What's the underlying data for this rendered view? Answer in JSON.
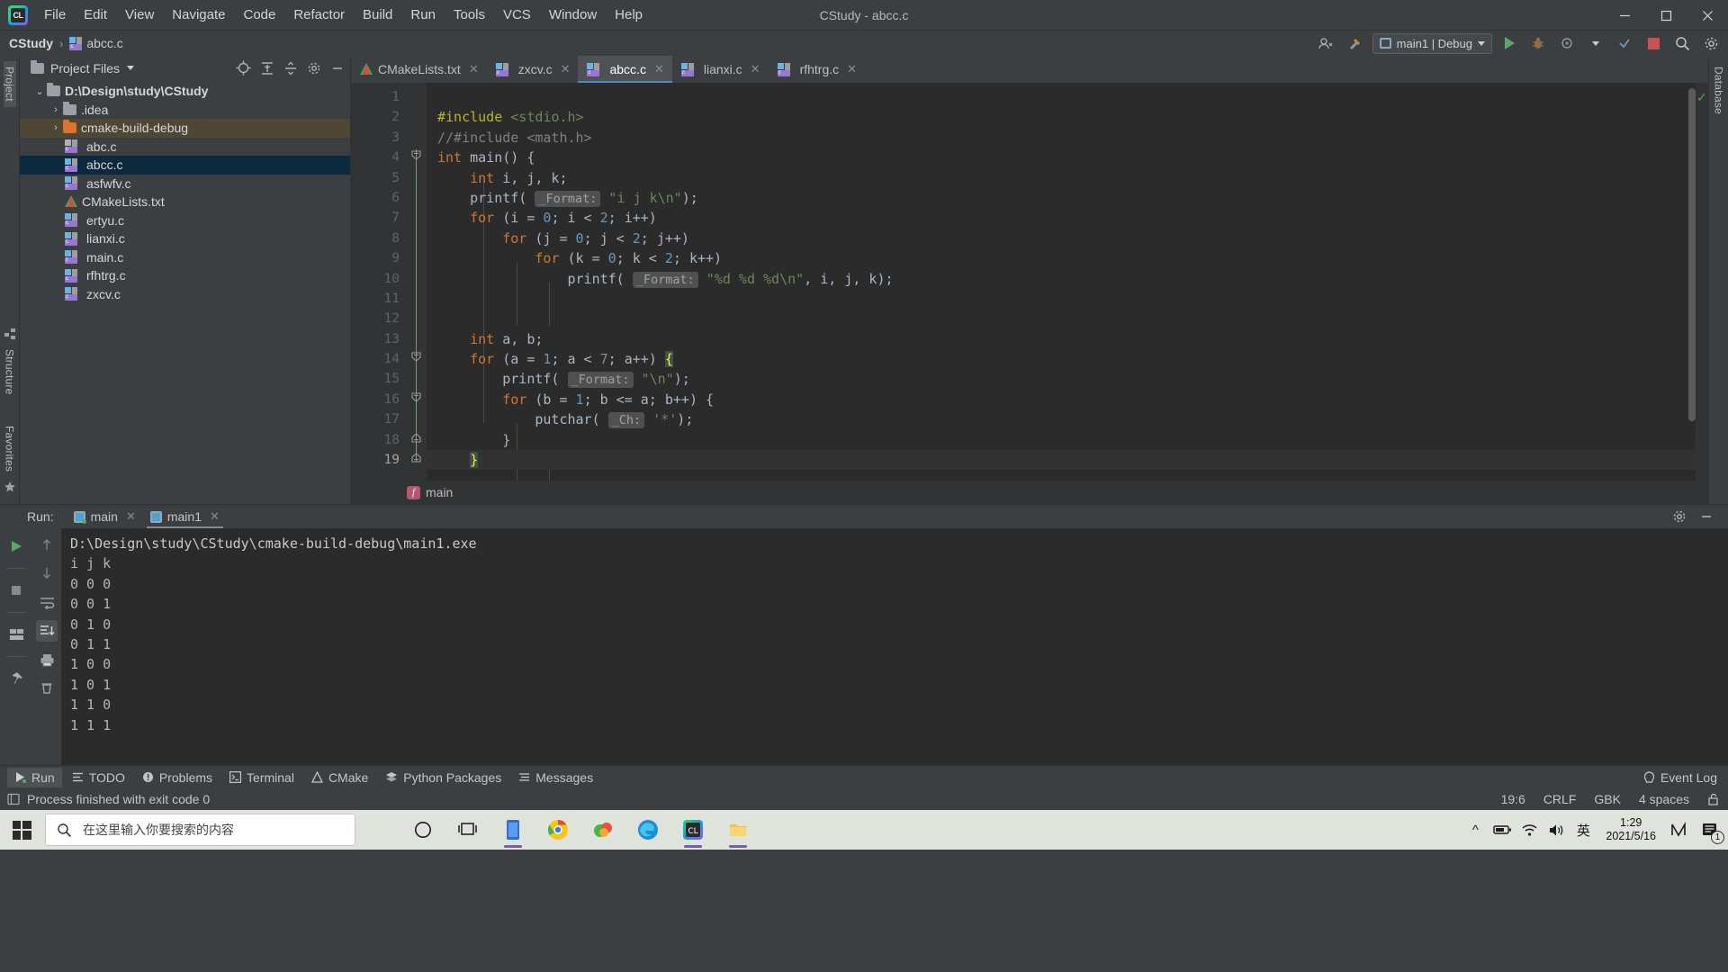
{
  "window": {
    "title": "CStudy - abcc.c",
    "minimize": "–",
    "maximize": "▢",
    "close": "✕"
  },
  "menu": [
    "File",
    "Edit",
    "View",
    "Navigate",
    "Code",
    "Refactor",
    "Build",
    "Run",
    "Tools",
    "VCS",
    "Window",
    "Help"
  ],
  "navbar": {
    "project": "CStudy",
    "separator": "›",
    "file": "abcc.c",
    "run_config": "main1 | Debug",
    "icons": {
      "account": "account-icon",
      "hammer": "build-hammer-icon",
      "run": "run-icon",
      "debug": "debug-icon",
      "attach": "attach-profiler-icon",
      "more": "more-run-icon",
      "coverage": "run-coverage-icon",
      "stop": "stop-icon",
      "search": "search-everywhere-icon",
      "settings": "settings-icon"
    }
  },
  "rails": {
    "left_top": "Project",
    "left_mid": "Structure",
    "left_bottom": "Favorites",
    "right_top": "Database"
  },
  "project_panel": {
    "title": "Project Files",
    "header_icons": [
      "locate-icon",
      "expand-all-icon",
      "collapse-all-icon",
      "settings-icon",
      "hide-icon"
    ],
    "tree": [
      {
        "label": "D:\\Design\\study\\CStudy",
        "type": "root-folder",
        "indent": 0,
        "arrow": "⌄",
        "state": "normal",
        "bold": true
      },
      {
        "label": ".idea",
        "type": "folder",
        "indent": 1,
        "arrow": "›",
        "state": "normal",
        "bold": false
      },
      {
        "label": "cmake-build-debug",
        "type": "folder-orange",
        "indent": 1,
        "arrow": "›",
        "state": "highlight",
        "bold": false
      },
      {
        "label": "abc.c",
        "type": "c-file",
        "indent": 2,
        "arrow": "",
        "state": "normal",
        "bold": false
      },
      {
        "label": "abcc.c",
        "type": "c-file",
        "indent": 2,
        "arrow": "",
        "state": "selected",
        "bold": false
      },
      {
        "label": "asfwfv.c",
        "type": "c-file",
        "indent": 2,
        "arrow": "",
        "state": "normal",
        "bold": false
      },
      {
        "label": "CMakeLists.txt",
        "type": "cmake-file",
        "indent": 2,
        "arrow": "",
        "state": "normal",
        "bold": false
      },
      {
        "label": "ertyu.c",
        "type": "c-file",
        "indent": 2,
        "arrow": "",
        "state": "normal",
        "bold": false
      },
      {
        "label": "lianxi.c",
        "type": "c-file",
        "indent": 2,
        "arrow": "",
        "state": "normal",
        "bold": false
      },
      {
        "label": "main.c",
        "type": "c-file",
        "indent": 2,
        "arrow": "",
        "state": "normal",
        "bold": false
      },
      {
        "label": "rfhtrg.c",
        "type": "c-file",
        "indent": 2,
        "arrow": "",
        "state": "normal",
        "bold": false
      },
      {
        "label": "zxcv.c",
        "type": "c-file",
        "indent": 2,
        "arrow": "",
        "state": "normal",
        "bold": false
      }
    ]
  },
  "editor": {
    "tabs": [
      {
        "label": "CMakeLists.txt",
        "icon": "cmake-file-icon",
        "active": false,
        "close": "✕"
      },
      {
        "label": "zxcv.c",
        "icon": "c-file-icon",
        "active": false,
        "close": "✕"
      },
      {
        "label": "abcc.c",
        "icon": "c-file-icon",
        "active": true,
        "close": "✕"
      },
      {
        "label": "lianxi.c",
        "icon": "c-file-icon",
        "active": false,
        "close": "✕"
      },
      {
        "label": "rfhtrg.c",
        "icon": "c-file-icon",
        "active": false,
        "close": "✕"
      }
    ],
    "lines": [
      {
        "n": "1",
        "text": ""
      },
      {
        "n": "2",
        "text": "#include <stdio.h>"
      },
      {
        "n": "3",
        "text": "//#include <math.h>"
      },
      {
        "n": "4",
        "text": "int main() {"
      },
      {
        "n": "5",
        "text": "    int i, j, k;"
      },
      {
        "n": "6",
        "text": "    printf( _Format: \"i j k\\n\");"
      },
      {
        "n": "7",
        "text": "    for (i = 0; i < 2; i++)"
      },
      {
        "n": "8",
        "text": "        for (j = 0; j < 2; j++)"
      },
      {
        "n": "9",
        "text": "            for (k = 0; k < 2; k++)"
      },
      {
        "n": "10",
        "text": "                printf( _Format: \"%d %d %d\\n\", i, j, k);"
      },
      {
        "n": "11",
        "text": ""
      },
      {
        "n": "12",
        "text": ""
      },
      {
        "n": "13",
        "text": "    int a, b;"
      },
      {
        "n": "14",
        "text": "    for (a = 1; a < 7; a++) {"
      },
      {
        "n": "15",
        "text": "        printf( _Format: \"\\n\");"
      },
      {
        "n": "16",
        "text": "        for (b = 1; b <= a; b++) {"
      },
      {
        "n": "17",
        "text": "            putchar( _Ch: '*');"
      },
      {
        "n": "18",
        "text": "        }"
      },
      {
        "n": "19",
        "text": "    }"
      }
    ],
    "breadcrumb": {
      "badge": "f",
      "label": "main"
    },
    "inspection_status": "✓"
  },
  "run_panel": {
    "label": "Run:",
    "tabs": [
      {
        "label": "main",
        "active": false,
        "close": "✕"
      },
      {
        "label": "main1",
        "active": true,
        "close": "✕"
      }
    ],
    "toolbar_left": [
      "rerun-icon",
      "stop-icon",
      "layout-icon",
      "pin-icon"
    ],
    "toolbar_right": [
      "up-arrow-icon",
      "down-arrow-icon",
      "soft-wrap-icon",
      "scroll-to-end-icon",
      "print-icon",
      "clear-all-icon"
    ],
    "settings_icon": "gear-icon",
    "minimize_icon": "minimize-icon",
    "console": [
      "D:\\Design\\study\\CStudy\\cmake-build-debug\\main1.exe",
      "i j k",
      "0 0 0",
      "0 0 1",
      "0 1 0",
      "0 1 1",
      "1 0 0",
      "1 0 1",
      "1 1 0",
      "1 1 1"
    ]
  },
  "tool_window_bar": {
    "buttons": [
      {
        "label": "Run",
        "icon": "run-icon",
        "active": true
      },
      {
        "label": "TODO",
        "icon": "todo-icon",
        "active": false
      },
      {
        "label": "Problems",
        "icon": "problems-icon",
        "active": false
      },
      {
        "label": "Terminal",
        "icon": "terminal-icon",
        "active": false
      },
      {
        "label": "CMake",
        "icon": "cmake-icon",
        "active": false
      },
      {
        "label": "Python Packages",
        "icon": "packages-icon",
        "active": false
      },
      {
        "label": "Messages",
        "icon": "messages-icon",
        "active": false
      }
    ],
    "event_log": {
      "label": "Event Log",
      "icon": "event-log-icon"
    }
  },
  "status_bar": {
    "message": "Process finished with exit code 0",
    "message_icon": "console-icon",
    "caret": "19:6",
    "line_sep": "CRLF",
    "encoding": "GBK",
    "indent": "4 spaces",
    "lock_icon": "unlocked-icon"
  },
  "taskbar": {
    "start": "windows-start-icon",
    "search_placeholder": "在这里输入你要搜索的内容",
    "search_icon": "search-icon",
    "items": [
      {
        "name": "cortana-icon",
        "active": false
      },
      {
        "name": "task-view-icon",
        "active": false
      },
      {
        "name": "store-icon",
        "active": true
      },
      {
        "name": "chrome-icon",
        "active": false
      },
      {
        "name": "wps-icon",
        "active": false
      },
      {
        "name": "edge-icon",
        "active": false
      },
      {
        "name": "clion-icon",
        "active": true
      },
      {
        "name": "folder-icon",
        "active": true
      }
    ],
    "tray": {
      "chevron": "^",
      "battery": "battery-icon",
      "wifi": "wifi-icon",
      "volume": "volume-icon",
      "ime": "英",
      "time": "1:29",
      "date": "2021/5/16",
      "onedrive": "M",
      "notifications": "notification-icon",
      "notif_count": "1"
    }
  },
  "colors": {
    "bg": "#3c3f41",
    "editor_bg": "#2b2b2b",
    "accent": "#4a88c7",
    "selection": "#0d293e",
    "keyword": "#cc7832",
    "number": "#6897bb",
    "string": "#6a8759",
    "comment": "#808080"
  }
}
